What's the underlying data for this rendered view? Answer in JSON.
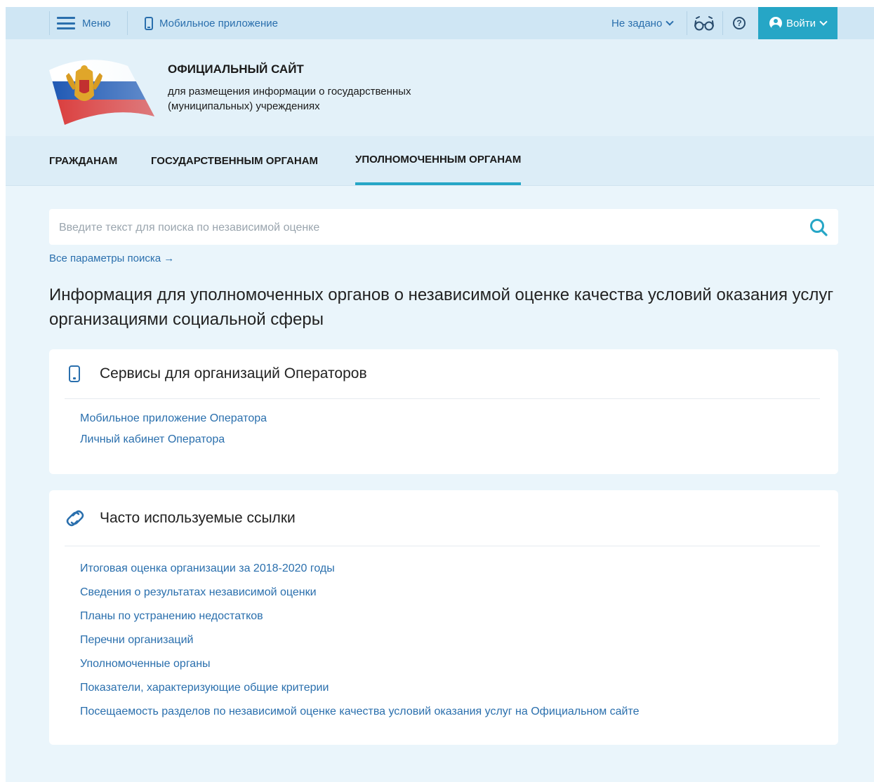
{
  "topbar": {
    "menu_label": "Меню",
    "mobile_app_label": "Мобильное приложение",
    "region_label": "Не задано",
    "login_label": "Войти",
    "help_symbol": "?"
  },
  "header": {
    "title": "ОФИЦИАЛЬНЫЙ САЙТ",
    "subtitle": "для размещения информации о государственных (муниципальных) учреждениях"
  },
  "nav": {
    "tabs": [
      {
        "label": "ГРАЖДАНАМ"
      },
      {
        "label": "ГОСУДАРСТВЕННЫМ ОРГАНАМ"
      },
      {
        "label": "УПОЛНОМОЧЕННЫМ ОРГАНАМ",
        "active": true
      }
    ]
  },
  "search": {
    "placeholder": "Введите текст для поиска по независимой оценке",
    "all_params_label": "Все параметры поиска →"
  },
  "main": {
    "heading": "Информация для уполномоченных органов о независимой оценке качества условий оказания услуг организациями социальной сферы"
  },
  "services_card": {
    "title": "Сервисы для организаций Операторов",
    "links": [
      "Мобильное приложение Оператора",
      "Личный кабинет Оператора"
    ]
  },
  "links_card": {
    "title": "Часто используемые ссылки",
    "links": [
      "Итоговая оценка организации за 2018-2020 годы",
      "Сведения о результатах независимой оценки",
      "Планы по устранению недостатков",
      "Перечни организаций",
      "Уполномоченные органы",
      "Показатели, характеризующие общие критерии",
      "Посещаемость разделов по независимой оценке качества условий оказания услуг на Официальном сайте"
    ]
  },
  "colors": {
    "accent": "#26a6c6",
    "link": "#2a6fad",
    "page_background": "#eaf5fb"
  }
}
